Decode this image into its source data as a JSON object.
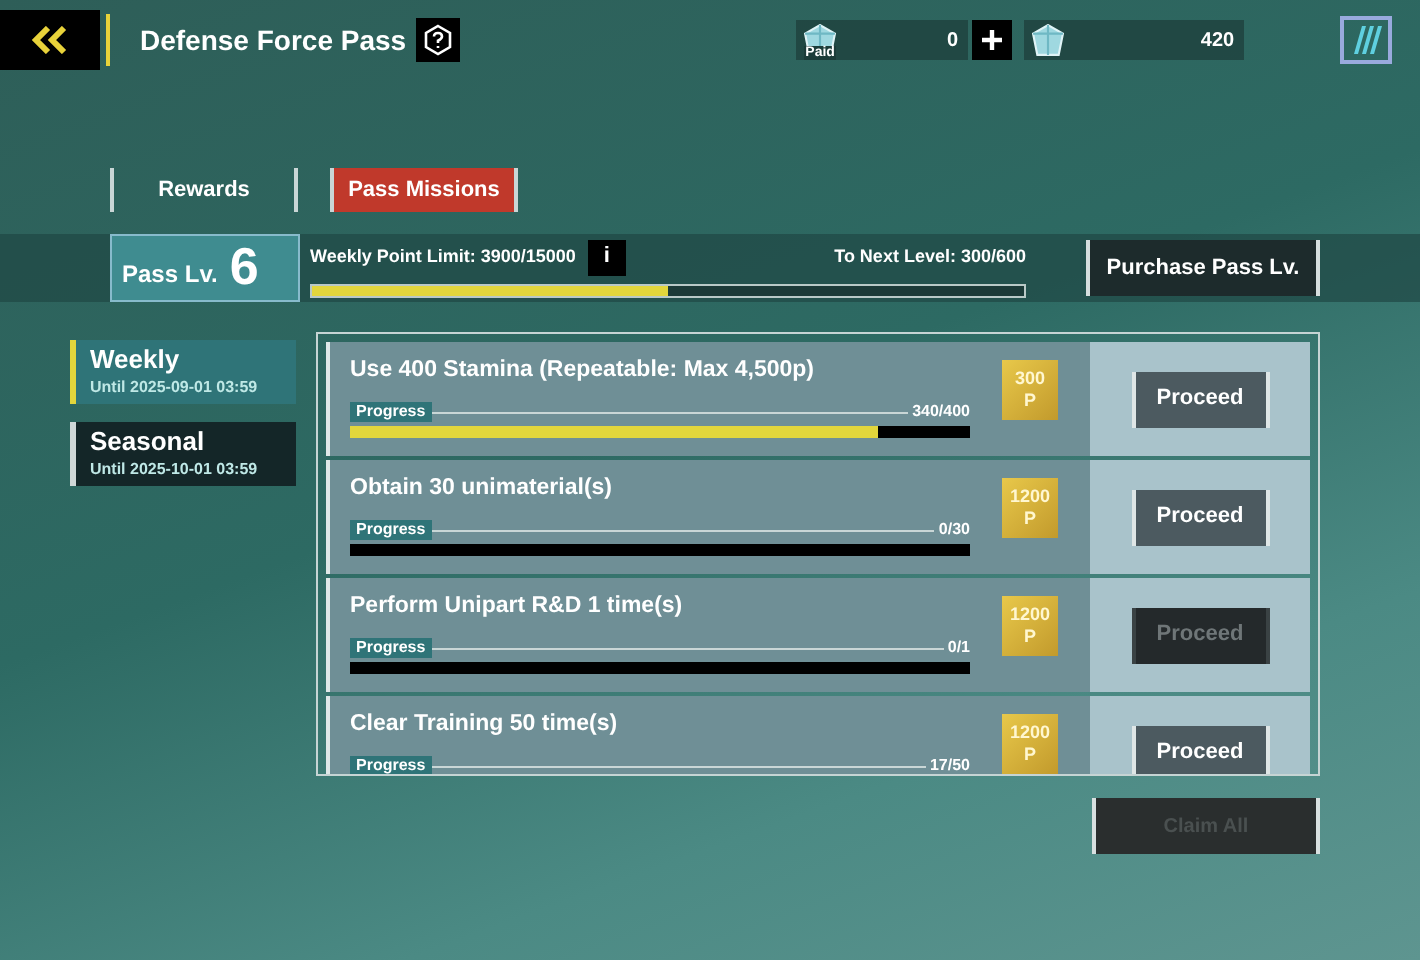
{
  "header": {
    "title": "Defense Force Pass",
    "currencies": [
      {
        "label": "Paid",
        "amount": "0"
      },
      {
        "amount": "420"
      }
    ]
  },
  "tabs": [
    {
      "label": "Rewards",
      "selected": false
    },
    {
      "label": "Pass Missions",
      "selected": true
    }
  ],
  "pass": {
    "label": "Pass Lv.",
    "level_number": "6",
    "weekly_limit": "Weekly Point Limit: 3900/15000",
    "info": "i",
    "next_level": "To Next Level: 300/600",
    "level": 0.5,
    "purchase": "Purchase Pass Lv."
  },
  "categories": [
    {
      "name": "Weekly",
      "until": "Until 2025-09-01 03:59",
      "selected": true
    },
    {
      "name": "Seasonal",
      "until": "Until 2025-10-01 03:59",
      "selected": false
    }
  ],
  "missions": [
    {
      "title": "Use 400 Stamina (Repeatable: Max 4,500p)",
      "progress_label": "Progress",
      "count": "340/400",
      "level": 0.85,
      "reward": "300",
      "reward_unit": "P",
      "button": "Proceed",
      "disabled": false
    },
    {
      "title": "Obtain 30 unimaterial(s)",
      "progress_label": "Progress",
      "count": "0/30",
      "reward": "1200",
      "reward_unit": "P",
      "button": "Proceed",
      "disabled": false
    },
    {
      "title": "Perform Unipart R&D 1 time(s)",
      "progress_label": "Progress",
      "count": "0/1",
      "reward": "1200",
      "reward_unit": "P",
      "button": "Proceed",
      "disabled": true
    },
    {
      "title": "Clear Training 50 time(s)",
      "progress_label": "Progress",
      "count": "17/50",
      "reward": "1200",
      "reward_unit": "P",
      "button": "Proceed",
      "disabled": false
    }
  ],
  "claim_all": {
    "label": "Claim All",
    "disabled": true
  }
}
